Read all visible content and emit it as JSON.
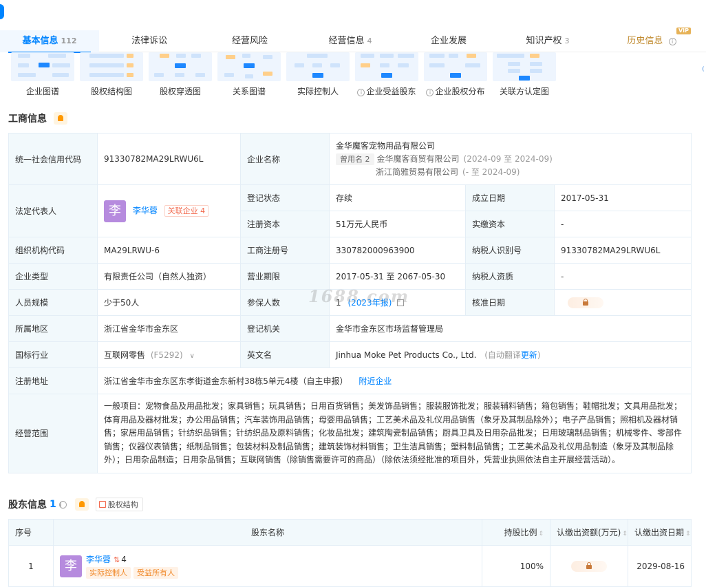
{
  "tabs": [
    {
      "label": "基本信息",
      "count": "112"
    },
    {
      "label": "法律诉讼",
      "count": ""
    },
    {
      "label": "经营风险",
      "count": ""
    },
    {
      "label": "经营信息",
      "count": "4"
    },
    {
      "label": "企业发展",
      "count": ""
    },
    {
      "label": "知识产权",
      "count": "3"
    },
    {
      "label": "历史信息",
      "count": ""
    }
  ],
  "vip_badge": "VIP",
  "graphs": [
    {
      "label": "企业图谱",
      "info": false
    },
    {
      "label": "股权结构图",
      "info": false
    },
    {
      "label": "股权穿透图",
      "info": false
    },
    {
      "label": "关系图谱",
      "info": false
    },
    {
      "label": "实际控制人",
      "info": false
    },
    {
      "label": "企业受益股东",
      "info": true
    },
    {
      "label": "企业股权分布",
      "info": true
    },
    {
      "label": "关联方认定图",
      "info": false
    }
  ],
  "business": {
    "title": "工商信息",
    "credit_code_label": "统一社会信用代码",
    "credit_code": "91330782MA29LRWU6L",
    "company_name_label": "企业名称",
    "company_name": "金华魔客宠物用品有限公司",
    "used_names_tag": "曾用名 2",
    "used_names": [
      {
        "name": "金华魔客商贸有限公司",
        "period": "(2024-09 至 2024-09)"
      },
      {
        "name": "浙江简雅贸易有限公司",
        "period": "(- 至 2024-09)"
      }
    ],
    "legal_rep_label": "法定代表人",
    "legal_rep_avatar": "李",
    "legal_rep": "李华蓉",
    "legal_rep_related": "关联企业 4",
    "status_label": "登记状态",
    "status": "存续",
    "found_date_label": "成立日期",
    "found_date": "2017-05-31",
    "reg_capital_label": "注册资本",
    "reg_capital": "51万元人民币",
    "paid_capital_label": "实缴资本",
    "paid_capital": "-",
    "org_code_label": "组织机构代码",
    "org_code": "MA29LRWU-6",
    "reg_no_label": "工商注册号",
    "reg_no": "330782000963900",
    "taxpayer_id_label": "纳税人识别号",
    "taxpayer_id": "91330782MA29LRWU6L",
    "type_label": "企业类型",
    "type": "有限责任公司（自然人独资）",
    "term_label": "营业期限",
    "term": "2017-05-31 至 2067-05-30",
    "taxpayer_qual_label": "纳税人资质",
    "taxpayer_qual": "-",
    "staff_label": "人员规模",
    "staff": "少于50人",
    "insured_label": "参保人数",
    "insured": "1",
    "insured_year": "(2023年报)",
    "approve_label": "核准日期",
    "region_label": "所属地区",
    "region": "浙江省金华市金东区",
    "authority_label": "登记机关",
    "authority": "金华市金东区市场监督管理局",
    "industry_label": "国标行业",
    "industry": "互联网零售",
    "industry_code": "(F5292)",
    "en_name_label": "英文名",
    "en_name": "Jinhua Moke Pet Products Co., Ltd.",
    "en_note": "(自动翻译",
    "en_update": "更新",
    "en_note_end": ")",
    "address_label": "注册地址",
    "address": "浙江省金华市金东区东孝街道金东新村38栋5单元4楼（自主申报）",
    "nearby": "附近企业",
    "scope_label": "经营范围",
    "scope": "一般项目：宠物食品及用品批发；家具销售；玩具销售；日用百货销售；美发饰品销售；服装服饰批发；服装辅料销售；箱包销售；鞋帽批发；文具用品批发；体育用品及器材批发；办公用品销售；汽车装饰用品销售；母婴用品销售；工艺美术品及礼仪用品销售（象牙及其制品除外）；电子产品销售；照相机及器材销售；家居用品销售；针纺织品销售；针纺织品及原料销售；化妆品批发；建筑陶瓷制品销售；厨具卫具及日用杂品批发；日用玻璃制品销售；机械零件、零部件销售；仪器仪表销售；纸制品销售；包装材料及制品销售；建筑装饰材料销售；卫生洁具销售；塑料制品销售；工艺美术品及礼仪用品制造（象牙及其制品除外）；日用杂品制造；日用杂品销售；互联网销售（除销售需要许可的商品）（除依法须经批准的项目外，凭营业执照依法自主开展经营活动）。"
  },
  "watermark": "1688.com",
  "shareholders": {
    "title": "股东信息",
    "count": "1",
    "equity_link": "股权结构",
    "headers": {
      "no": "序号",
      "name": "股东名称",
      "ratio": "持股比例",
      "capital": "认缴出资额(万元)",
      "date": "认缴出资日期"
    },
    "rows": [
      {
        "no": "1",
        "avatar": "李",
        "name": "李华蓉",
        "related_count": "4",
        "tags": [
          "实际控制人",
          "受益所有人"
        ],
        "ratio": "100%",
        "date": "2029-08-16"
      }
    ]
  }
}
